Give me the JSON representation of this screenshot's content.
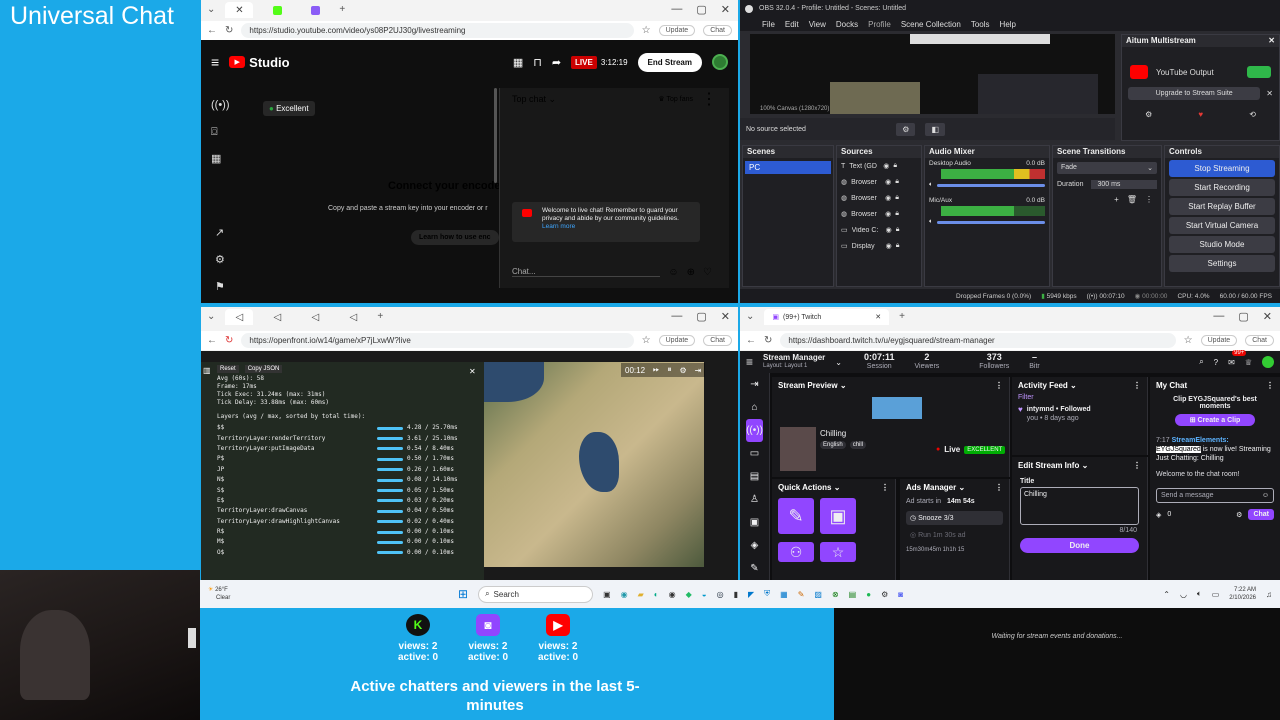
{
  "app_title": "Universal Chat",
  "youtube": {
    "url": "https://studio.youtube.com/video/ys08P2UJ30g/livestreaming",
    "update_pill": "Update",
    "chat_pill": "Chat",
    "brand": "Studio",
    "live_badge": "LIVE",
    "live_time": "3:12:19",
    "end_stream": "End Stream",
    "stream_health": "Excellent",
    "connect_title": "Connect your encode",
    "connect_desc": "Copy and paste a stream key into your encoder or r",
    "learn_btn": "Learn how to use enc",
    "top_chat": "Top chat",
    "top_fans": "Top fans",
    "welcome_msg": "Welcome to live chat! Remember to guard your privacy and abide by our community guidelines.",
    "learn_more": "Learn more",
    "chat_placeholder": "Chat..."
  },
  "obs": {
    "title": "OBS 32.0.4 - Profile: Untitled - Scenes: Untitled",
    "menu": [
      "File",
      "Edit",
      "View",
      "Docks",
      "Profile",
      "Scene Collection",
      "Tools",
      "Help"
    ],
    "multistream_title": "Aitum Multistream",
    "youtube_output": "YouTube Output",
    "upgrade": "Upgrade to Stream Suite",
    "canvas_label": "100%   Canvas (1280x720)",
    "no_source": "No source selected",
    "scenes_header": "Scenes",
    "scene_item": "PC",
    "sources_header": "Sources",
    "sources": [
      "Text (GD",
      "Browser",
      "Browser",
      "Browser",
      "Video C:",
      "Display"
    ],
    "mixer_header": "Audio Mixer",
    "desktop_audio": "Desktop Audio",
    "desktop_db": "0.0 dB",
    "mic_aux": "Mic/Aux",
    "mic_db": "0.0 dB",
    "transitions_header": "Scene Transitions",
    "transition": "Fade",
    "duration_label": "Duration",
    "duration": "300 ms",
    "controls_header": "Controls",
    "controls": [
      "Stop Streaming",
      "Start Recording",
      "Start Replay Buffer",
      "Start Virtual Camera",
      "Studio Mode",
      "Settings"
    ],
    "status_dropped": "Dropped Frames 0 (0.0%)",
    "status_kbps": "5949 kbps",
    "status_live": "00:07:10",
    "status_rec": "00:00:00",
    "status_cpu": "CPU: 4.0%",
    "status_fps": "60.00 / 60.00 FPS"
  },
  "openfront": {
    "url": "https://openfront.io/w14/game/xP7jLxwW?live",
    "update_pill": "Update",
    "chat_pill": "Chat",
    "reset": "Reset",
    "copy_json": "Copy JSON",
    "avg": "Avg (60s): 58",
    "frame": "Frame: 17ms",
    "tick_exec": "Tick Exec: 31.24ms (max: 31ms)",
    "tick_delay": "Tick Delay: 33.88ms (max: 60ms)",
    "layers_title": "Layers (avg / max, sorted by total time):",
    "layers": [
      {
        "name": "$$",
        "val": "4.28 / 25.70ms"
      },
      {
        "name": "TerritoryLayer:renderTerritory",
        "val": "3.61 / 25.10ms"
      },
      {
        "name": "TerritoryLayer:putImageData",
        "val": "0.54 / 8.40ms"
      },
      {
        "name": "P$",
        "val": "0.50 / 1.70ms"
      },
      {
        "name": "JP",
        "val": "0.26 / 1.60ms"
      },
      {
        "name": "N$",
        "val": "0.08 / 14.10ms"
      },
      {
        "name": "S$",
        "val": "0.05 / 1.50ms"
      },
      {
        "name": "E$",
        "val": "0.03 / 0.20ms"
      },
      {
        "name": "TerritoryLayer:drawCanvas",
        "val": "0.04 / 0.50ms"
      },
      {
        "name": "TerritoryLayer:drawHighlightCanvas",
        "val": "0.02 / 0.40ms"
      },
      {
        "name": "R$",
        "val": "0.00 / 0.10ms"
      },
      {
        "name": "M$",
        "val": "0.00 / 0.10ms"
      },
      {
        "name": "O$",
        "val": "0.00 / 0.10ms"
      }
    ],
    "timer": "00:12"
  },
  "twitch": {
    "tab": "(99+) Twitch",
    "url": "https://dashboard.twitch.tv/u/eygjsquared/stream-manager",
    "update_pill": "Update",
    "chat_pill": "Chat",
    "title": "Stream Manager",
    "layout": "Layout: Layout 1",
    "session_time": "0:07:11",
    "session_label": "Session",
    "viewers": "2",
    "viewers_label": "Viewers",
    "followers": "373",
    "followers_label": "Followers",
    "bitrate_label": "Bitr",
    "badge": "99+",
    "stream_preview": "Stream Preview",
    "stream_title": "Chilling",
    "language": "English",
    "tag": "chill",
    "live": "Live",
    "health": "EXCELLENT",
    "activity_feed": "Activity Feed",
    "filter": "Filter",
    "follower_name": "intymnd",
    "followed": "Followed",
    "followed_when": "you • 8 days ago",
    "edit_info": "Edit Stream Info",
    "title_label": "Title",
    "title_value": "Chilling",
    "char_count": "8/140",
    "done": "Done",
    "quick_actions": "Quick Actions",
    "ads_manager": "Ads Manager",
    "ad_starts": "Ad starts in",
    "ad_time": "14m 54s",
    "snooze": "Snooze 3/3",
    "run_ad": "Run 1m 30s ad",
    "ad_sched": "15m30m45m  1h1h 15",
    "my_chat": "My Chat",
    "clip_title": "Clip EYGJSquared's best moments",
    "create_clip": "Create a Clip",
    "chat_time": "7:17",
    "chat_user": "StreamElements:",
    "chat_mention": "EYGJSquared",
    "chat_text": "is now live! Streaming Just Chatting: Chilling",
    "welcome": "Welcome to the chat room!",
    "send_placeholder": "Send a message",
    "points": "0",
    "chat_btn": "Chat"
  },
  "taskbar": {
    "weather_temp": "26°F",
    "weather_desc": "Clear",
    "search": "Search",
    "time": "7:22 AM",
    "date": "2/10/2026"
  },
  "stats": [
    {
      "platform": "Kick",
      "views": "views: 2",
      "active": "active: 0",
      "color": "#53fc18"
    },
    {
      "platform": "Twitch",
      "views": "views: 2",
      "active": "active: 0",
      "color": "#9146ff"
    },
    {
      "platform": "YouTube",
      "views": "views: 2",
      "active": "active: 0",
      "color": "#ff0000"
    }
  ],
  "stats_caption": "Active chatters and viewers in the last 5-minutes",
  "events_waiting": "Waiting for stream events and donations..."
}
